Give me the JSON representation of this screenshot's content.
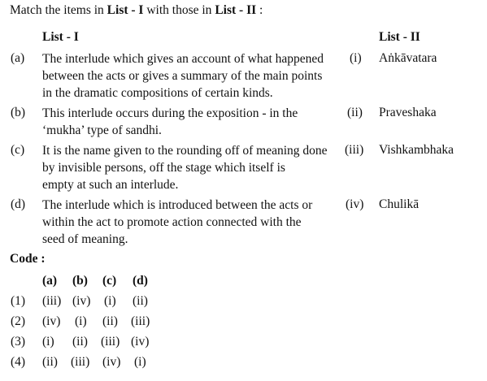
{
  "question": {
    "prefix": "Match the items in ",
    "list1": "List - I",
    "middle": " with those in ",
    "list2": "List - II",
    "suffix": " :"
  },
  "headers": {
    "list1": "List - I",
    "list2": "List - II"
  },
  "items": [
    {
      "label": "(a)",
      "lines": [
        "The interlude which gives an account of what happened",
        "between the acts or gives a summary of the main points",
        "in the dramatic compositions of certain kinds."
      ],
      "match_label": "(i)",
      "match_text": "Aṅkāvatara"
    },
    {
      "label": "(b)",
      "lines": [
        "This interlude occurs during the exposition - in the",
        "‘mukha’ type of sandhi."
      ],
      "match_label": "(ii)",
      "match_text": "Praveshaka"
    },
    {
      "label": "(c)",
      "lines": [
        "It is the name given to the rounding off of meaning done",
        "by invisible persons, off the stage which itself is",
        "empty at such an interlude."
      ],
      "match_label": "(iii)",
      "match_text": "Vishkambhaka"
    },
    {
      "label": "(d)",
      "lines": [
        "The interlude which is introduced between the acts or",
        "within the act to promote action connected with the",
        "seed of meaning."
      ],
      "match_label": "(iv)",
      "match_text": "Chulikā"
    }
  ],
  "code": {
    "title": "Code :",
    "headers": [
      "(a)",
      "(b)",
      "(c)",
      "(d)"
    ],
    "options": [
      {
        "label": "(1)",
        "values": [
          "(iii)",
          "(iv)",
          "(i)",
          "(ii)"
        ]
      },
      {
        "label": "(2)",
        "values": [
          "(iv)",
          "(i)",
          "(ii)",
          "(iii)"
        ]
      },
      {
        "label": "(3)",
        "values": [
          "(i)",
          "(ii)",
          "(iii)",
          "(iv)"
        ]
      },
      {
        "label": "(4)",
        "values": [
          "(ii)",
          "(iii)",
          "(iv)",
          "(i)"
        ]
      }
    ]
  }
}
